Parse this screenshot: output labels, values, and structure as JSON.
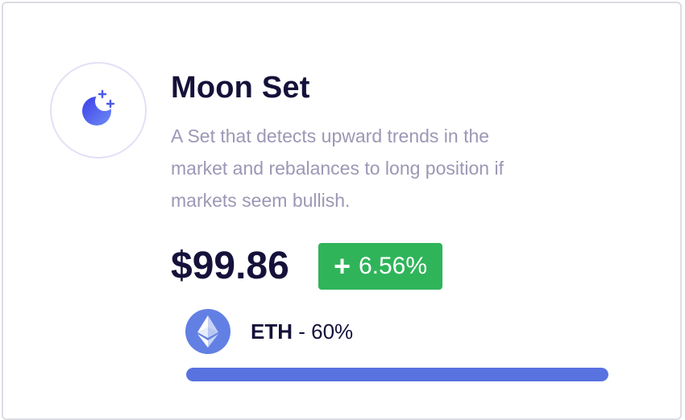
{
  "card": {
    "icon": "moon-stars-icon",
    "title": "Moon Set",
    "description": "A Set that detects upward trends in the market and rebalances to long position if markets seem bullish.",
    "price": "$99.86",
    "change": {
      "sign": "+",
      "value": "6.56%",
      "color": "#2fb45a"
    },
    "token": {
      "icon": "ethereum-icon",
      "symbol": "ETH",
      "separator": " - ",
      "percent": "60%"
    },
    "allocation_bar": {
      "color": "#5872e0",
      "fill_fraction": 1.0
    }
  }
}
